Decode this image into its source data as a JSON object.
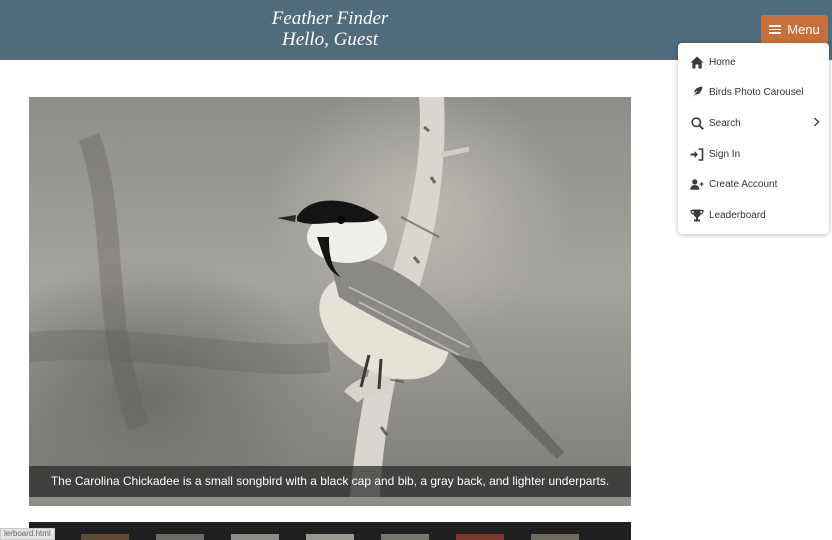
{
  "header": {
    "site_title": "Feather Finder",
    "greeting": "Hello, Guest"
  },
  "menu_button": {
    "label": "Menu",
    "icon": "hamburger-icon"
  },
  "menu": {
    "items": [
      {
        "label": "Home",
        "icon": "home-icon"
      },
      {
        "label": "Birds Photo Carousel",
        "icon": "feather-icon"
      },
      {
        "label": "Search",
        "icon": "search-icon",
        "has_submenu": true
      },
      {
        "label": "Sign In",
        "icon": "sign-in-icon"
      },
      {
        "label": "Create Account",
        "icon": "add-user-icon"
      },
      {
        "label": "Leaderboard",
        "icon": "trophy-icon"
      }
    ]
  },
  "carousel": {
    "caption": "The Carolina Chickadee is a small songbird with a black cap and bib, a gray back, and lighter underparts."
  },
  "status_bar": {
    "url": "lerboard.html"
  },
  "colors": {
    "header_bg": "#4f6b7c",
    "menu_button_bg": "#c96f3a"
  }
}
